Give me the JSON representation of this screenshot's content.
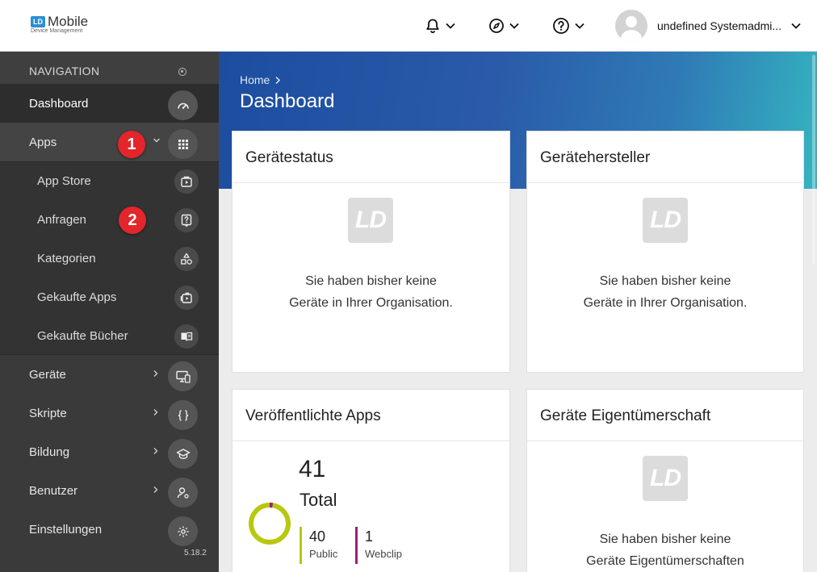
{
  "app": {
    "logo_mark": "LD",
    "logo_title": "Mobile",
    "logo_subtitle": "Device Management"
  },
  "topbar": {
    "notifications_icon": "bell-icon",
    "compass_icon": "compass-icon",
    "help_icon": "help-circle-icon",
    "user_name": "undefined Systemadmi..."
  },
  "sidebar": {
    "header": "NAVIGATION",
    "items": [
      {
        "label": "Dashboard",
        "icon": "speedometer-icon"
      },
      {
        "label": "Apps",
        "icon": "grid-icon"
      },
      {
        "label": "App Store",
        "icon": "play-folder-icon"
      },
      {
        "label": "Anfragen",
        "icon": "question-doc-icon"
      },
      {
        "label": "Kategorien",
        "icon": "shapes-icon"
      },
      {
        "label": "Gekaufte Apps",
        "icon": "purchased-apps-icon"
      },
      {
        "label": "Gekaufte Bücher",
        "icon": "book-icon"
      },
      {
        "label": "Geräte",
        "icon": "devices-icon"
      },
      {
        "label": "Skripte",
        "icon": "braces-icon"
      },
      {
        "label": "Bildung",
        "icon": "graduation-cap-icon"
      },
      {
        "label": "Benutzer",
        "icon": "user-gear-icon"
      },
      {
        "label": "Einstellungen",
        "icon": "gear-icon"
      }
    ],
    "version": "5.18.2",
    "markers": [
      "1",
      "2"
    ]
  },
  "main": {
    "breadcrumb": "Home",
    "title": "Dashboard",
    "cards": {
      "status": {
        "title": "Gerätestatus",
        "logo": "LD",
        "empty_line1": "Sie haben bisher keine",
        "empty_line2": "Geräte in Ihrer Organisation."
      },
      "manufacturer": {
        "title": "Gerätehersteller",
        "logo": "LD",
        "empty_line1": "Sie haben bisher keine",
        "empty_line2": "Geräte in Ihrer Organisation."
      },
      "published": {
        "title": "Veröffentlichte Apps",
        "total": "41",
        "total_label": "Total",
        "legend": [
          {
            "value": "40",
            "label": "Public",
            "color": "#b9c70e"
          },
          {
            "value": "1",
            "label": "Webclip",
            "color": "#9b1f7a"
          }
        ]
      },
      "ownership": {
        "title": "Geräte Eigentümerschaft",
        "logo": "LD",
        "empty_line1": "Sie haben bisher keine",
        "empty_line2": "Geräte Eigentümerschaften"
      }
    }
  },
  "colors": {
    "sidebar_bg": "#3a3a3a",
    "hero_start": "#1c4d9f",
    "hero_end": "#35b4c0",
    "marker": "#e3262b",
    "public": "#b9c70e",
    "webclip": "#9b1f7a"
  }
}
